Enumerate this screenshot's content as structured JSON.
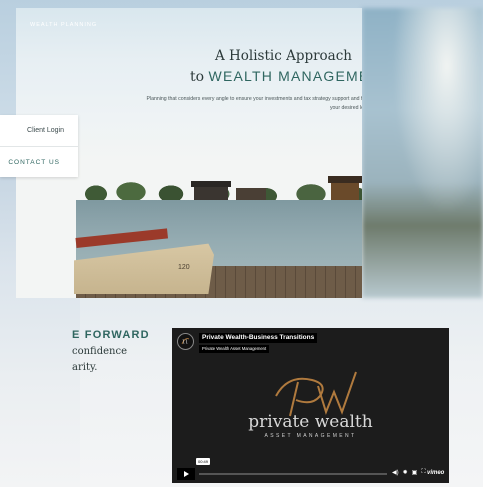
{
  "hero": {
    "eyebrow": "WEALTH PLANNING",
    "title_line1": "A Holistic Approach",
    "title_line2_prefix": "to",
    "title_line2_accent": "WEALTH MANAGEMENT.",
    "subtitle": "Planning that considers every angle to ensure your investments and tax strategy support and further your desired legacy.",
    "bench_number": "120"
  },
  "menu": {
    "client_login": "Client Login",
    "contact_us": "CONTACT US"
  },
  "section": {
    "heading": "E FORWARD",
    "line1": "confidence",
    "line2": "arity."
  },
  "video": {
    "title": "Private Wealth-Business Transitions",
    "subtitle": "Private Wealth Asset Management",
    "brand_name": "private wealth",
    "brand_tagline": "ASSET MANAGEMENT",
    "time": "00:49",
    "provider": "vimeo",
    "icons": [
      "play-icon",
      "volume-icon",
      "settings-icon",
      "pip-icon",
      "fullscreen-icon"
    ]
  },
  "colors": {
    "accent": "#2f6660",
    "text": "#2c3a3a",
    "video_bg": "#1c1c1c",
    "monogram": "#b07a3e"
  }
}
